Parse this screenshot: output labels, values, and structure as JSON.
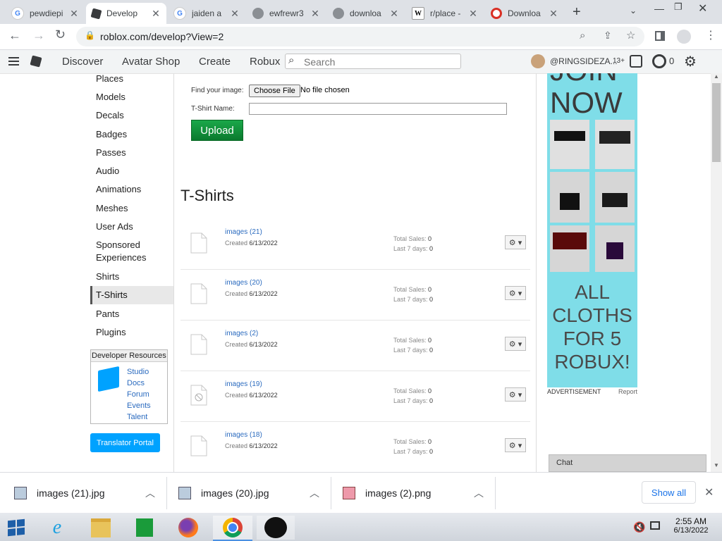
{
  "tabs": [
    {
      "title": "pewdiepi",
      "icon": "google-icon"
    },
    {
      "title": "Develop",
      "icon": "roblox-icon",
      "active": true
    },
    {
      "title": "jaiden a",
      "icon": "google-icon"
    },
    {
      "title": "ewfrewr3",
      "icon": "globe-icon"
    },
    {
      "title": "downloa",
      "icon": "globe-icon"
    },
    {
      "title": "r/place -",
      "icon": "wikipedia-icon"
    },
    {
      "title": "Downloa",
      "icon": "redirect-icon"
    }
  ],
  "address": {
    "url": "roblox.com/develop?View=2"
  },
  "nav": {
    "discover": "Discover",
    "avatar_shop": "Avatar Shop",
    "create": "Create",
    "robux": "Robux",
    "search_placeholder": "Search",
    "username": "@RINGSIDEZA...",
    "age": "13+",
    "robux_count": "0"
  },
  "sidebar": {
    "items": [
      "Places",
      "Models",
      "Decals",
      "Badges",
      "Passes",
      "Audio",
      "Animations",
      "Meshes",
      "User Ads",
      "Sponsored Experiences",
      "Shirts",
      "T-Shirts",
      "Pants",
      "Plugins"
    ],
    "active": "T-Shirts",
    "dev_resources": {
      "title": "Developer Resources",
      "links": [
        "Studio",
        "Docs",
        "Forum",
        "Events",
        "Talent"
      ]
    },
    "translator_portal": "Translator Portal"
  },
  "upload": {
    "find_image_label": "Find your image:",
    "choose_file": "Choose File",
    "no_file": "No file chosen",
    "name_label": "T-Shirt Name:",
    "name_value": "",
    "upload_button": "Upload"
  },
  "tshirts": {
    "title": "T-Shirts",
    "created_label": "Created",
    "total_sales_label": "Total Sales:",
    "last7_label": "Last 7 days:",
    "items": [
      {
        "name": "images (21)",
        "created": "6/13/2022",
        "total_sales": "0",
        "last7": "0",
        "thumb": "file-icon"
      },
      {
        "name": "images (20)",
        "created": "6/13/2022",
        "total_sales": "0",
        "last7": "0",
        "thumb": "file-icon"
      },
      {
        "name": "images (2)",
        "created": "6/13/2022",
        "total_sales": "0",
        "last7": "0",
        "thumb": "file-icon"
      },
      {
        "name": "images (19)",
        "created": "6/13/2022",
        "total_sales": "0",
        "last7": "0",
        "thumb": "blocked-file-icon"
      },
      {
        "name": "images (18)",
        "created": "6/13/2022",
        "total_sales": "0",
        "last7": "0",
        "thumb": "file-icon"
      }
    ]
  },
  "ad": {
    "top_text": "JOIN",
    "top_text2": "NOW",
    "bottom_text": [
      "ALL",
      "CLOTHS",
      "FOR 5",
      "ROBUX!"
    ],
    "label": "ADVERTISEMENT",
    "report": "Report"
  },
  "chat": {
    "label": "Chat"
  },
  "downloads": {
    "items": [
      {
        "name": "images (21).jpg"
      },
      {
        "name": "images (20).jpg"
      },
      {
        "name": "images (2).png"
      }
    ],
    "show_all": "Show all"
  },
  "taskbar": {
    "time": "2:55 AM",
    "date": "6/13/2022"
  },
  "colors": {
    "upload_green": "#0a7a2e",
    "link_blue": "#2b6bbf",
    "translator_blue": "#00a2ff",
    "ad_bg": "#7fdde8"
  }
}
